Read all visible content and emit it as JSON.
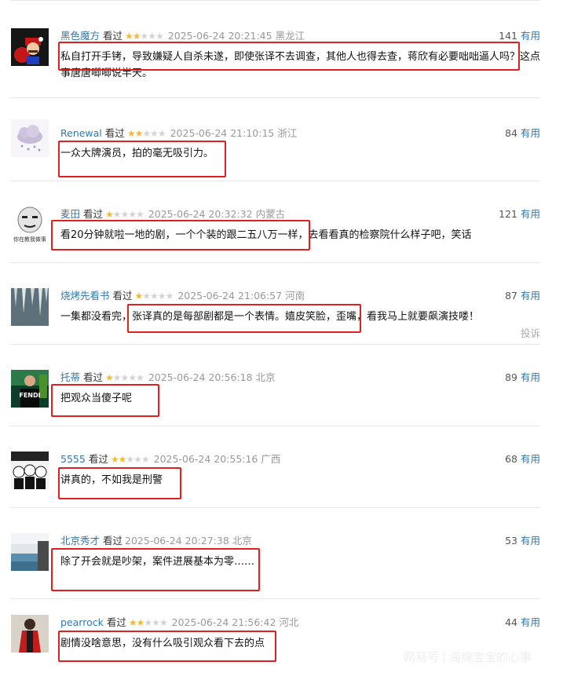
{
  "useful_label": "有用",
  "report_label": "投诉",
  "watermark": {
    "brand": "网易号",
    "account": "海绵宝宝的心事"
  },
  "colors": {
    "accent_link": "#3377aa",
    "star_on": "#f5b833",
    "highlight_box": "#e0201c"
  },
  "reviews": [
    {
      "user": "黑色魔方",
      "status": "看过",
      "rating": 2,
      "time": "2025-06-24 20:21:45",
      "location": "黑龙江",
      "votes": "141",
      "content": "私自打开手铐，导致嫌疑人自杀未遂，即使张译不去调查，其他人也得去查，蒋欣有必要咄咄逼人吗？这点事唐唐唧唧说半天。",
      "avatar": "mario-avatar"
    },
    {
      "user": "Renewal",
      "status": "看过",
      "rating": 2,
      "time": "2025-06-24 21:10:15",
      "location": "浙江",
      "votes": "84",
      "content": "一众大牌演员，拍的毫无吸引力。",
      "avatar": "cloud-avatar"
    },
    {
      "user": "麦田",
      "status": "看过",
      "rating": 1,
      "time": "2025-06-24 20:32:32",
      "location": "内蒙古",
      "votes": "121",
      "content": "看20分钟就啦一地的剧，一个个装的跟二五八万一样，去看看真的检察院什么样子吧，笑话",
      "avatar": "meme-avatar",
      "avatar_text": "你在教我做事情"
    },
    {
      "user": "烧烤先看书",
      "status": "看过",
      "rating": 1,
      "time": "2025-06-24 21:06:57",
      "location": "河南",
      "votes": "87",
      "content": "一集都没看完，张译真的是每部剧都是一个表情。嬉皮笑脸，歪嘴，看我马上就要飙演技喽！",
      "avatar": "icicle-avatar",
      "report": true
    },
    {
      "user": "托蒂",
      "status": "看过",
      "rating": 1,
      "time": "2025-06-24 20:56:18",
      "location": "北京",
      "votes": "89",
      "content": "把观众当傻子呢",
      "avatar": "fendi-avatar",
      "avatar_text": "FENDI"
    },
    {
      "user": "5555",
      "status": "看过",
      "rating": 2,
      "time": "2025-06-24 20:55:16",
      "location": "广西",
      "votes": "68",
      "content": "讲真的，不如我是刑警",
      "avatar": "cartoon-avatar"
    },
    {
      "user": "北京秀才",
      "status": "看过",
      "rating": 1,
      "time": "2025-06-24 20:27:38",
      "location": "北京",
      "votes": "53",
      "content": "除了开会就是吵架，案件进展基本为零……",
      "avatar": "sea-avatar"
    },
    {
      "user": "pearrock",
      "status": "看过",
      "rating": 2,
      "time": "2025-06-24 21:56:42",
      "location": "河北",
      "votes": "44",
      "content": "剧情没啥意思，没有什么吸引观众看下去的点",
      "avatar": "red-coat-avatar"
    }
  ]
}
